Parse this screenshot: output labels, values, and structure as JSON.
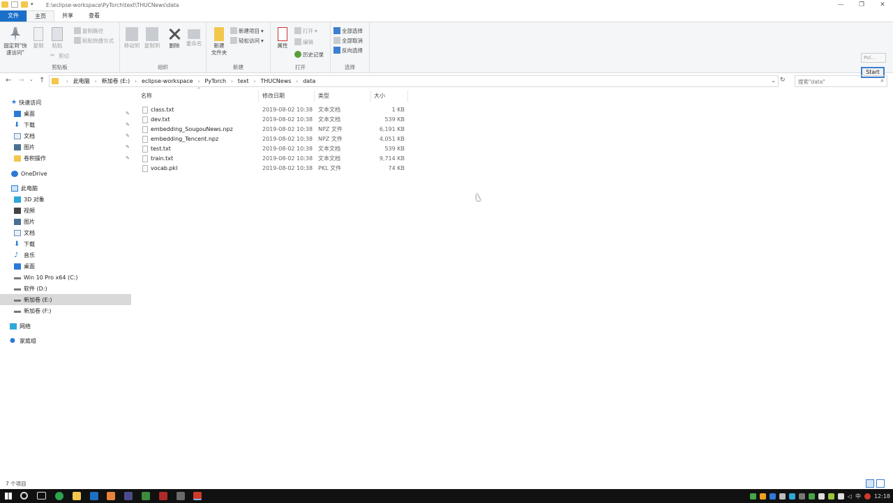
{
  "title_bar": {
    "path": "E:\\eclipse-workspace\\PyTorch\\text\\THUCNews\\data",
    "min": "—",
    "max": "❐",
    "close": "✕"
  },
  "tabs": [
    "文件",
    "主页",
    "共享",
    "查看"
  ],
  "ribbon": {
    "clipboard": {
      "label": "剪贴板",
      "pin": "固定到\"快速访问\"",
      "copy": "复制",
      "paste": "粘贴",
      "copy_path": "复制路径",
      "paste_shortcut": "粘贴快捷方式",
      "cut": "剪切"
    },
    "organize": {
      "label": "组织",
      "move_to": "移动到",
      "copy_to": "复制到",
      "delete": "删除",
      "rename": "重命名"
    },
    "new": {
      "label": "新建",
      "new_folder": "新建\n文件夹",
      "new_item": "新建项目",
      "easy_access": "轻松访问"
    },
    "open": {
      "label": "打开",
      "properties": "属性",
      "open": "打开",
      "edit": "编辑",
      "history": "历史记录"
    },
    "select": {
      "label": "选择",
      "select_all": "全部选择",
      "select_none": "全部取消",
      "invert": "反向选择"
    }
  },
  "plugin": {
    "pol_label": "Pol...",
    "start_label": "Start"
  },
  "breadcrumb": [
    "此电脑",
    "新加卷 (E:)",
    "eclipse-workspace",
    "PyTorch",
    "text",
    "THUCNews",
    "data"
  ],
  "search": {
    "placeholder": "搜索\"data\""
  },
  "nav": {
    "quick_access": "快速访问",
    "quick_items": [
      "桌面",
      "下载",
      "文档",
      "图片",
      "卷积操作"
    ],
    "onedrive": "OneDrive",
    "this_pc": "此电脑",
    "pc_items": [
      "3D 对象",
      "视频",
      "图片",
      "文档",
      "下载",
      "音乐",
      "桌面",
      "Win 10 Pro x64 (C:)",
      "软件 (D:)",
      "新加卷 (E:)",
      "新加卷 (F:)"
    ],
    "network": "网络",
    "homegroup": "家庭组"
  },
  "columns": {
    "name": "名称",
    "date": "修改日期",
    "type": "类型",
    "size": "大小"
  },
  "files": [
    {
      "name": "class.txt",
      "date": "2019-08-02 10:38",
      "type": "文本文档",
      "size": "1 KB"
    },
    {
      "name": "dev.txt",
      "date": "2019-08-02 10:38",
      "type": "文本文档",
      "size": "539 KB"
    },
    {
      "name": "embedding_SougouNews.npz",
      "date": "2019-08-02 10:38",
      "type": "NPZ 文件",
      "size": "6,191 KB"
    },
    {
      "name": "embedding_Tencent.npz",
      "date": "2019-08-02 10:38",
      "type": "NPZ 文件",
      "size": "4,051 KB"
    },
    {
      "name": "test.txt",
      "date": "2019-08-02 10:38",
      "type": "文本文档",
      "size": "539 KB"
    },
    {
      "name": "train.txt",
      "date": "2019-08-02 10:38",
      "type": "文本文档",
      "size": "9,714 KB"
    },
    {
      "name": "vocab.pkl",
      "date": "2019-08-02 10:38",
      "type": "PKL 文件",
      "size": "74 KB"
    }
  ],
  "status": {
    "count": "7 个项目"
  },
  "taskbar": {
    "ime": "中",
    "time": "12:18"
  }
}
